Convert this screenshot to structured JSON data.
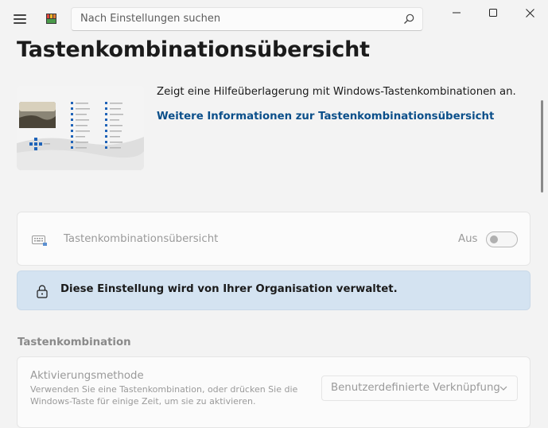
{
  "search": {
    "placeholder": "Nach Einstellungen suchen"
  },
  "page": {
    "title": "Tastenkombinationsübersicht"
  },
  "hero": {
    "description": "Zeigt eine Hilfeüberlagerung mit Windows-Tastenkombinationen an.",
    "link": "Weitere Informationen zur Tastenkombinationsübersicht"
  },
  "setting": {
    "label": "Tastenkombinationsübersicht",
    "state": "Aus",
    "enabled": false
  },
  "banner": {
    "message": "Diese Einstellung wird von Ihrer Organisation verwaltet."
  },
  "section": {
    "title": "Tastenkombination"
  },
  "activation": {
    "title": "Aktivierungsmethode",
    "description": "Verwenden Sie eine Tastenkombination, oder drücken Sie die Windows-Taste für einige Zeit, um sie zu aktivieren.",
    "selected": "Benutzerdefinierte Verknüpfung"
  },
  "colors": {
    "link": "#0b4f8a",
    "banner": "#d4e3f1",
    "background": "#f3f3f3"
  }
}
